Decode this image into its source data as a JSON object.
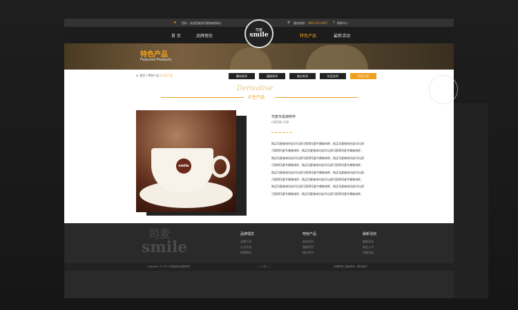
{
  "topbar": {
    "welcome": "您好，欢迎您来到司麦咖啡网站！",
    "phone_label": "服务热线：",
    "phone": "400-123-4567",
    "help": "帮助中心"
  },
  "nav": {
    "items": [
      {
        "label": "首 页"
      },
      {
        "label": "品牌理念"
      },
      {
        "label": "特色产品"
      },
      {
        "label": "最新活动"
      }
    ],
    "logo_cn": "司麦",
    "logo_en": "smile"
  },
  "banner": {
    "title": "特色产品",
    "subtitle": "Featured Products"
  },
  "breadcrumb": {
    "home": "首页",
    "level1": "特色产品",
    "current": "衍生产品"
  },
  "tabs": [
    {
      "label": "圆包系列"
    },
    {
      "label": "蛋糕系列"
    },
    {
      "label": "甜点系列"
    },
    {
      "label": "饮品系列"
    },
    {
      "label": "衍生产品"
    }
  ],
  "section": {
    "title_en": "Derivative",
    "title_cn": "衍生产品"
  },
  "product": {
    "name": "司麦专属咖啡杯",
    "name_en": "COFFEE CUP",
    "cup_logo": "smile",
    "description": [
      "购买司麦咖啡另加10元即可获得司麦专属咖啡杯，购买司麦咖啡另加10元即",
      "可获得司麦专属咖啡杯，购买司麦咖啡另加10元即可获得司麦专属咖啡杯，",
      "购买司麦咖啡另加10元即可获得司麦专属咖啡杯，购买司麦咖啡另加10元即",
      "可获得司麦专属咖啡杯，购买司麦咖啡另加10元即可获得司麦专属咖啡杯，",
      "购买司麦咖啡另加10元即可获得司麦专属咖啡杯，购买司麦咖啡另加10元即",
      "可获得司麦专属咖啡杯，购买司麦咖啡另加10元即可获得司麦专属咖啡杯，",
      "购买司麦咖啡另加10元即可获得司麦专属咖啡杯，购买司麦咖啡另加10元即",
      "可获得司麦专属咖啡杯，购买司麦咖啡另加10元即可获得司麦专属咖啡杯。"
    ]
  },
  "footer": {
    "watermark_cn": "司麦",
    "watermark_en": "smile",
    "columns": [
      {
        "head": "品牌理念",
        "links": [
          "品牌介绍",
          "企业文化",
          "经营理念"
        ]
      },
      {
        "head": "特色产品",
        "links": [
          "面包系列",
          "蛋糕系列",
          "甜点系列"
        ]
      },
      {
        "head": "最新活动",
        "links": [
          "最新活动",
          "新品上市",
          "优惠活动"
        ]
      }
    ]
  },
  "copyright": {
    "left": "Copyright © 2015 司麦烘焙 版权所有",
    "center": "— 1 页 1 —",
    "right": "法律声明 | 隐私条约 | 联系我们"
  },
  "colors": {
    "accent": "#f0a020"
  }
}
